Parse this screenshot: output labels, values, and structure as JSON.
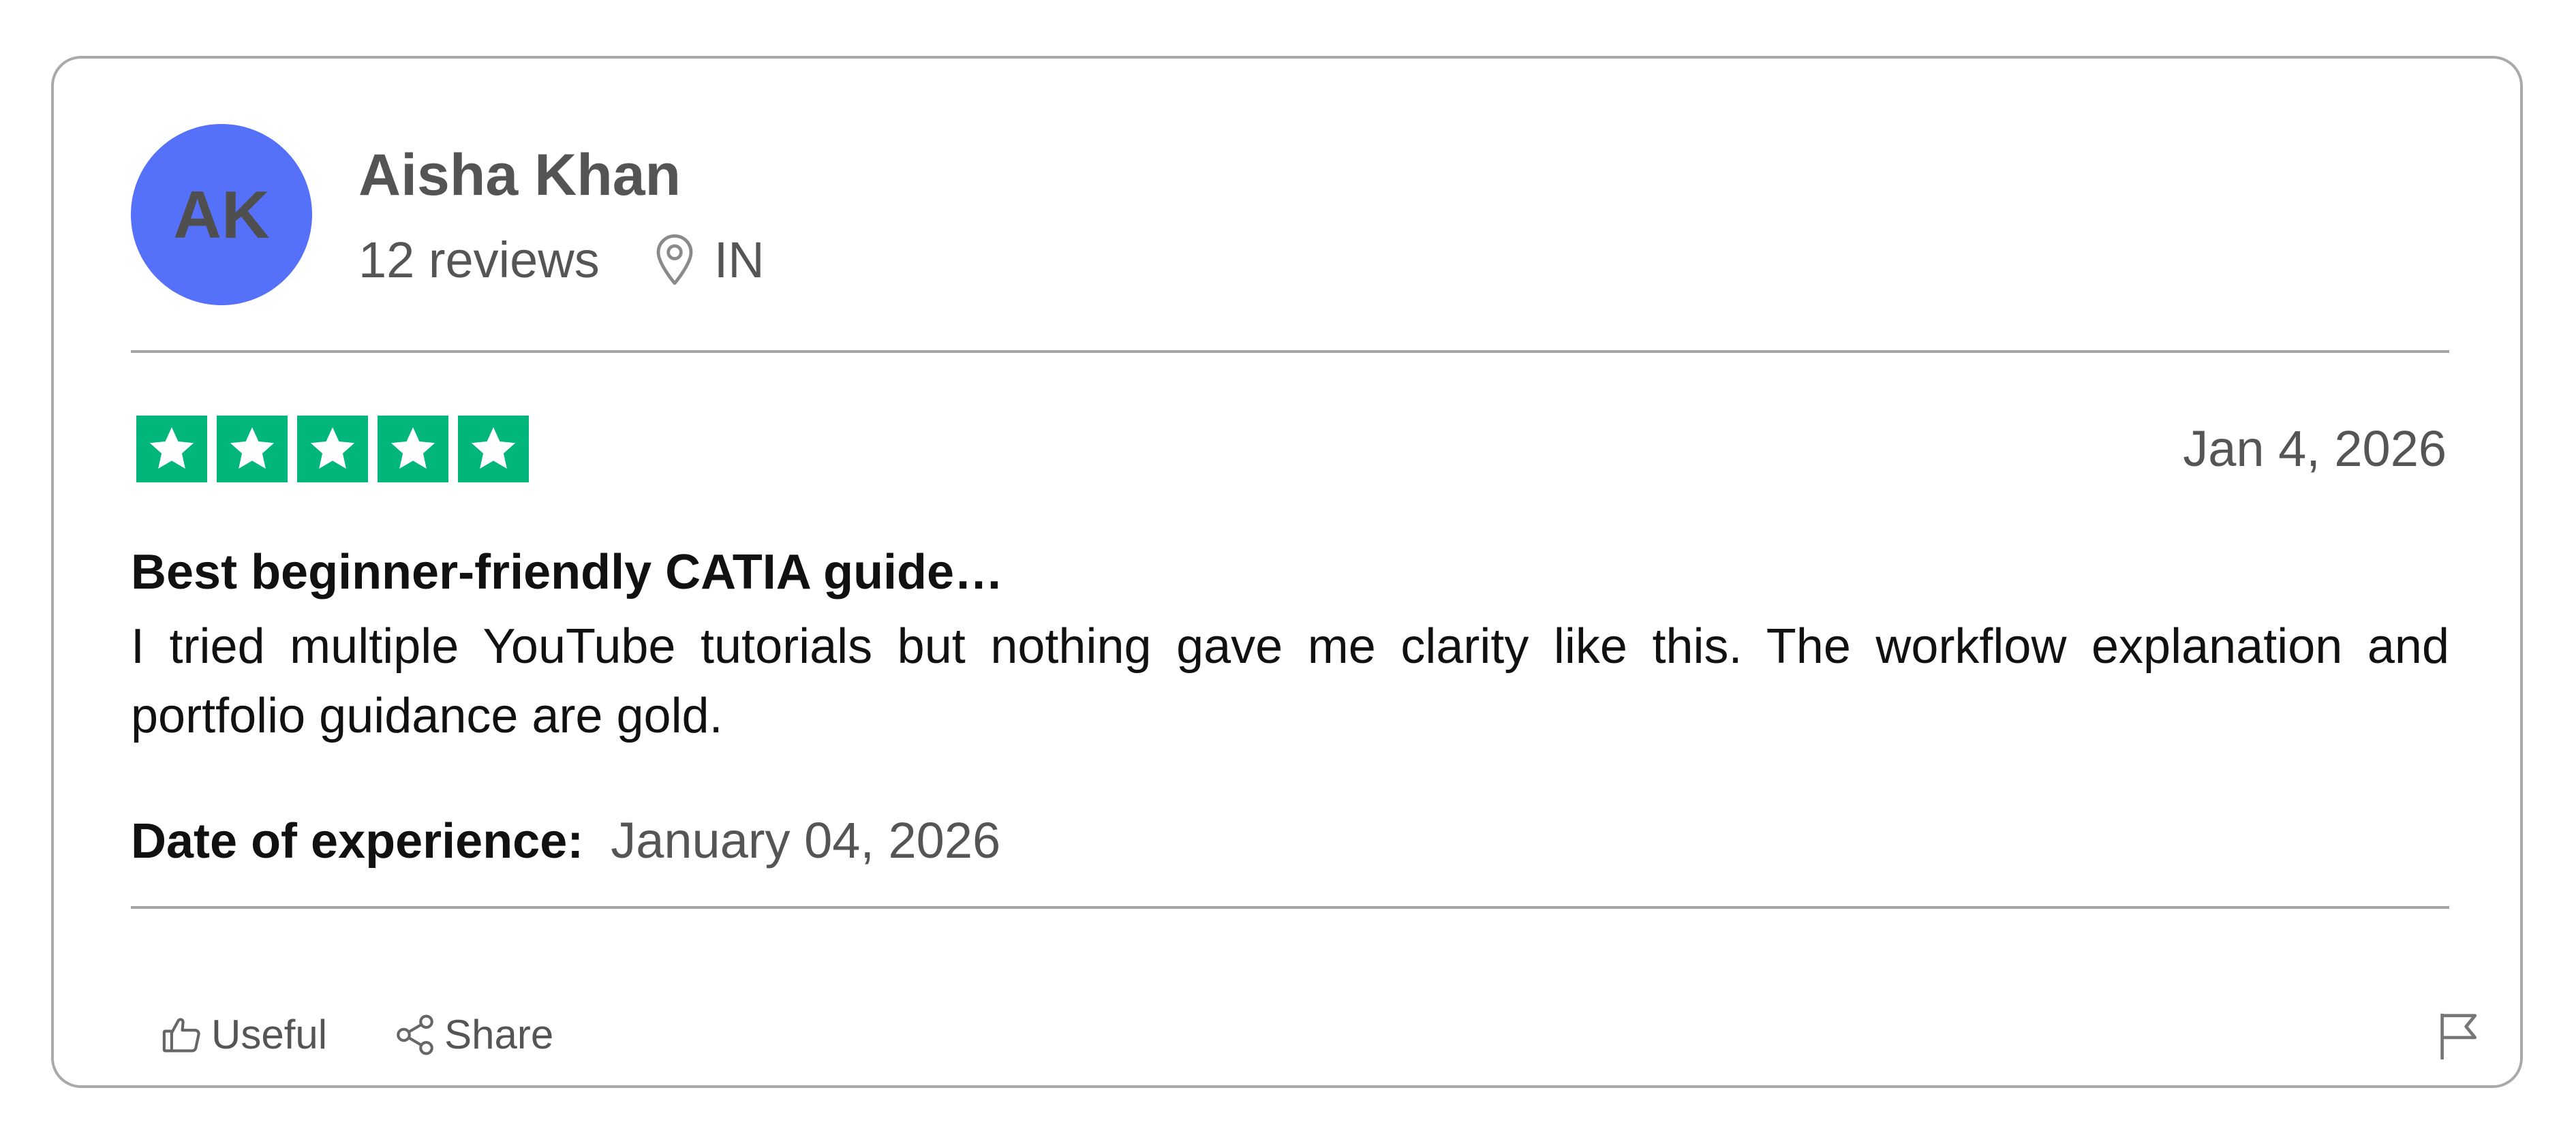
{
  "colors": {
    "avatar_bg": "#5571fa",
    "star_bg": "#00b67a",
    "star_fg": "#ffffff",
    "border": "#a9a9a9"
  },
  "reviewer": {
    "initials": "AK",
    "name": "Aisha Khan",
    "reviews_count": "12 reviews",
    "location_icon": "map-pin-icon",
    "location": "IN"
  },
  "review": {
    "rating": 5,
    "max_rating": 5,
    "date": "Jan 4, 2026",
    "title": "Best beginner-friendly CATIA guide…",
    "body": "I tried multiple YouTube tutorials but nothing gave me clarity like this. The workflow explanation and portfolio guidance are gold.",
    "experience_label": "Date of experience:",
    "experience_date": "January 04, 2026"
  },
  "actions": {
    "useful_label": "Useful",
    "useful_icon": "thumbs-up-icon",
    "share_label": "Share",
    "share_icon": "share-icon",
    "report_icon": "flag-icon"
  }
}
